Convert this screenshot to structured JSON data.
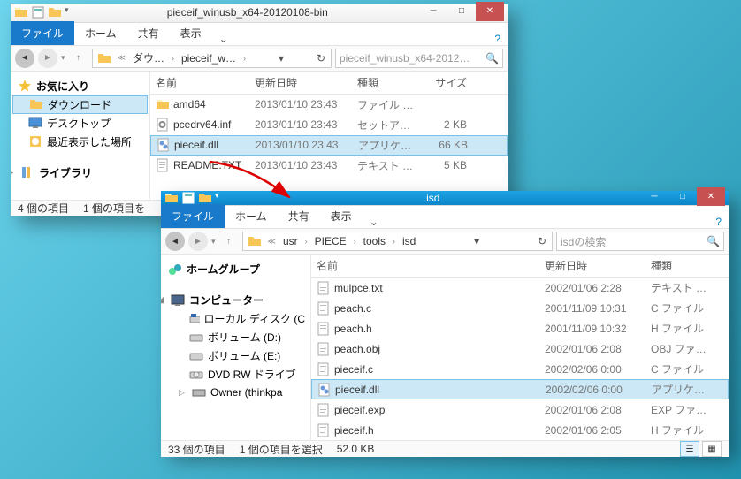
{
  "win1": {
    "title": "pieceif_winusb_x64-20120108-bin",
    "ribbon": {
      "file": "ファイル",
      "home": "ホーム",
      "share": "共有",
      "view": "表示"
    },
    "breadcrumb": [
      "ダウ…",
      "pieceif_w…"
    ],
    "search_placeholder": "pieceif_winusb_x64-2012…",
    "nav": {
      "favorites": "お気に入り",
      "downloads": "ダウンロード",
      "desktop": "デスクトップ",
      "recent": "最近表示した場所",
      "libraries": "ライブラリ"
    },
    "cols": {
      "name": "名前",
      "date": "更新日時",
      "type": "種類",
      "size": "サイズ"
    },
    "files": [
      {
        "name": "amd64",
        "date": "2013/01/10 23:43",
        "type": "ファイル フォ…",
        "size": "",
        "icon": "folder"
      },
      {
        "name": "pcedrv64.inf",
        "date": "2013/01/10 23:43",
        "type": "セットアップ…",
        "size": "2 KB",
        "icon": "setup"
      },
      {
        "name": "pieceif.dll",
        "date": "2013/01/10 23:43",
        "type": "アプリケーシ…",
        "size": "66 KB",
        "icon": "dll",
        "sel": true
      },
      {
        "name": "README.TXT",
        "date": "2013/01/10 23:43",
        "type": "テキスト ド…",
        "size": "5 KB",
        "icon": "txt"
      }
    ],
    "status": {
      "count": "4 個の項目",
      "sel": "1 個の項目を"
    }
  },
  "win2": {
    "title": "isd",
    "ribbon": {
      "file": "ファイル",
      "home": "ホーム",
      "share": "共有",
      "view": "表示"
    },
    "breadcrumb": [
      "usr",
      "PIECE",
      "tools",
      "isd"
    ],
    "search_placeholder": "isdの検索",
    "nav": {
      "homegroup": "ホームグループ",
      "computer": "コンピューター",
      "localc": "ローカル ディスク (C",
      "vold": "ボリューム (D:)",
      "vole": "ボリューム (E:)",
      "dvd": "DVD RW ドライブ",
      "owner": "Owner (thinkpa"
    },
    "cols": {
      "name": "名前",
      "date": "更新日時",
      "type": "種類"
    },
    "files": [
      {
        "name": "mulpce.txt",
        "date": "2002/01/06 2:28",
        "type": "テキスト ドキュ",
        "icon": "txt"
      },
      {
        "name": "peach.c",
        "date": "2001/11/09 10:31",
        "type": "C ファイル",
        "icon": "c"
      },
      {
        "name": "peach.h",
        "date": "2001/11/09 10:32",
        "type": "H ファイル",
        "icon": "h"
      },
      {
        "name": "peach.obj",
        "date": "2002/01/06 2:08",
        "type": "OBJ ファイル",
        "icon": "obj"
      },
      {
        "name": "pieceif.c",
        "date": "2002/02/06 0:00",
        "type": "C ファイル",
        "icon": "c"
      },
      {
        "name": "pieceif.dll",
        "date": "2002/02/06 0:00",
        "type": "アプリケーション",
        "icon": "dll",
        "sel": true
      },
      {
        "name": "pieceif.exp",
        "date": "2002/01/06 2:08",
        "type": "EXP ファイル",
        "icon": "exp"
      },
      {
        "name": "pieceif.h",
        "date": "2002/01/06 2:05",
        "type": "H ファイル",
        "icon": "h"
      }
    ],
    "status": {
      "count": "33 個の項目",
      "sel": "1 個の項目を選択",
      "size": "52.0 KB"
    }
  }
}
